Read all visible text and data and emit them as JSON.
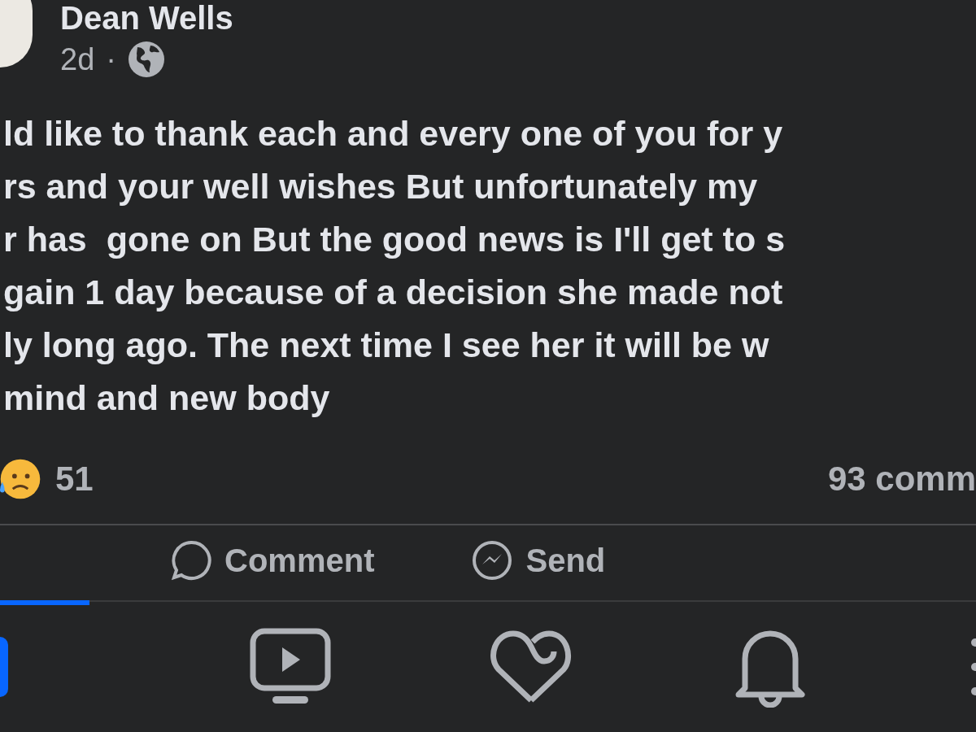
{
  "post": {
    "author": "Dean Wells",
    "time": "2d",
    "separator": "·",
    "lines": [
      "ld like to thank each and every one of you for y",
      "rs and your well wishes But unfortunately my",
      "r has  gone on But the good news is I'll get to s",
      "gain 1 day because of a decision she made not",
      "ly long ago. The next time I see her it will be w",
      "mind and new body"
    ],
    "reaction_count": "51",
    "comments": "93 comm",
    "actions": [
      {
        "kind": "comment",
        "label": "Comment"
      },
      {
        "kind": "send",
        "label": "Send"
      }
    ]
  },
  "tabs": [
    {
      "kind": "home",
      "selected": true
    },
    {
      "kind": "video",
      "selected": false
    },
    {
      "kind": "dating",
      "selected": false
    },
    {
      "kind": "notifications",
      "selected": false
    },
    {
      "kind": "menu",
      "selected": false
    }
  ]
}
